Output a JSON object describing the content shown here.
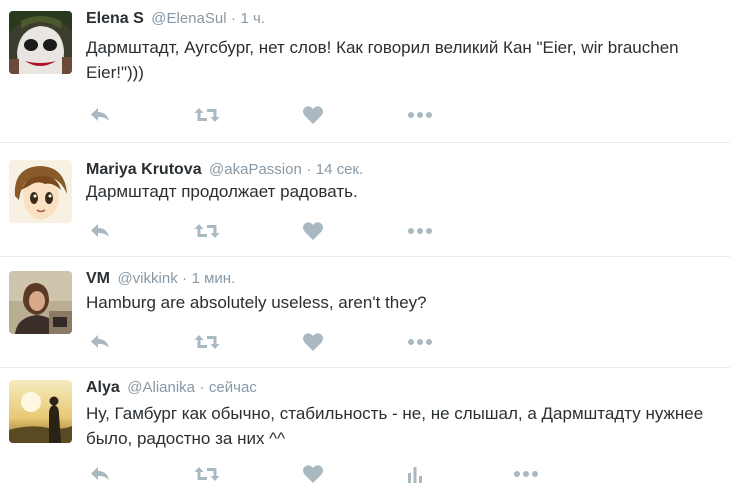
{
  "tweets": [
    {
      "name": "Elena S",
      "handle": "@ElenaSul",
      "separator": "·",
      "time": "1 ч.",
      "text": "Дармштадт, Аугсбург, нет слов! Как говорил великий Кан \"Eier, wir brauchen Eier!\")))",
      "avatar": "joker-face-avatar"
    },
    {
      "name": "Mariya Krutova",
      "handle": "@akaPassion",
      "separator": "·",
      "time": "14 сек.",
      "text": "Дармштадт продолжает радовать.",
      "avatar": "anime-boy-avatar"
    },
    {
      "name": "VM",
      "handle": "@vikkink",
      "separator": "·",
      "time": "1 мин.",
      "text": "Hamburg are absolutely useless, aren't they?",
      "avatar": "person-photo-avatar"
    },
    {
      "name": "Alya",
      "handle": "@Alianika",
      "separator": "·",
      "time": "сейчас",
      "text": "Ну, Гамбург как обычно, стабильность - не, не слышал, а Дармштадту нужнее было, радостно за них ^^",
      "avatar": "sunset-silhouette-avatar"
    }
  ],
  "icons": {
    "reply": "reply-icon",
    "retweet": "retweet-icon",
    "like": "heart-icon",
    "analytics": "analytics-icon",
    "more": "more-icon"
  },
  "colors": {
    "name": "#292f33",
    "meta": "#8899a6",
    "action_icon": "#aab8c2",
    "divider": "#e6ecf0"
  }
}
